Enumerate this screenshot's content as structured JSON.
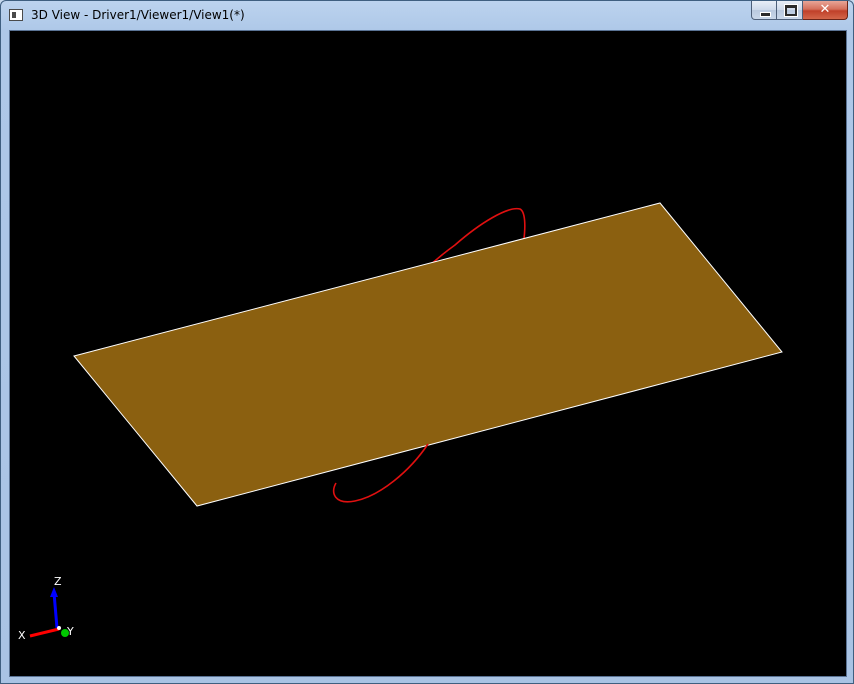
{
  "window": {
    "title": "3D View - Driver1/Viewer1/View1(*)",
    "icon": "window-app-icon",
    "buttons": {
      "minimize": "minimize-icon",
      "maximize": "maximize-icon",
      "close": "close-icon"
    }
  },
  "scene": {
    "background_color": "#000000",
    "plane_color": "#8b6010",
    "plane_edge_color": "#ffffff",
    "curve_color": "#e01010"
  },
  "triedron": {
    "axis_x_label": "X",
    "axis_y_label": "Y",
    "axis_z_label": "Z",
    "axis_x_color": "#ff0000",
    "axis_y_color": "#00c800",
    "axis_z_color": "#0000ff"
  }
}
